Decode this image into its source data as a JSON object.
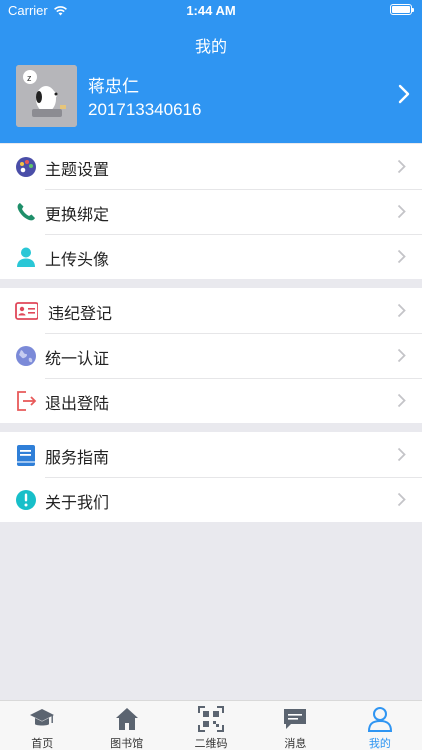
{
  "status_bar": {
    "carrier": "Carrier",
    "time": "1:44 AM"
  },
  "header": {
    "title": "我的"
  },
  "profile": {
    "name": "蒋忠仁",
    "id": "201713340616"
  },
  "groups": [
    {
      "items": [
        {
          "label": "主题设置",
          "icon": "palette-icon"
        },
        {
          "label": "更换绑定",
          "icon": "phone-icon"
        },
        {
          "label": "上传头像",
          "icon": "person-icon"
        }
      ]
    },
    {
      "items": [
        {
          "label": "违纪登记",
          "icon": "id-card-icon"
        },
        {
          "label": "统一认证",
          "icon": "globe-icon"
        },
        {
          "label": "退出登陆",
          "icon": "logout-icon"
        }
      ]
    },
    {
      "items": [
        {
          "label": "服务指南",
          "icon": "book-icon"
        },
        {
          "label": "关于我们",
          "icon": "info-icon"
        }
      ]
    }
  ],
  "tabbar": [
    {
      "label": "首页",
      "icon": "graduation-cap-icon"
    },
    {
      "label": "图书馆",
      "icon": "house-icon"
    },
    {
      "label": "二维码",
      "icon": "qr-code-icon"
    },
    {
      "label": "消息",
      "icon": "chat-bubble-icon"
    },
    {
      "label": "我的",
      "icon": "user-icon",
      "active": true
    }
  ],
  "colors": {
    "primary": "#2f95f2",
    "background": "#e9e9ee"
  }
}
